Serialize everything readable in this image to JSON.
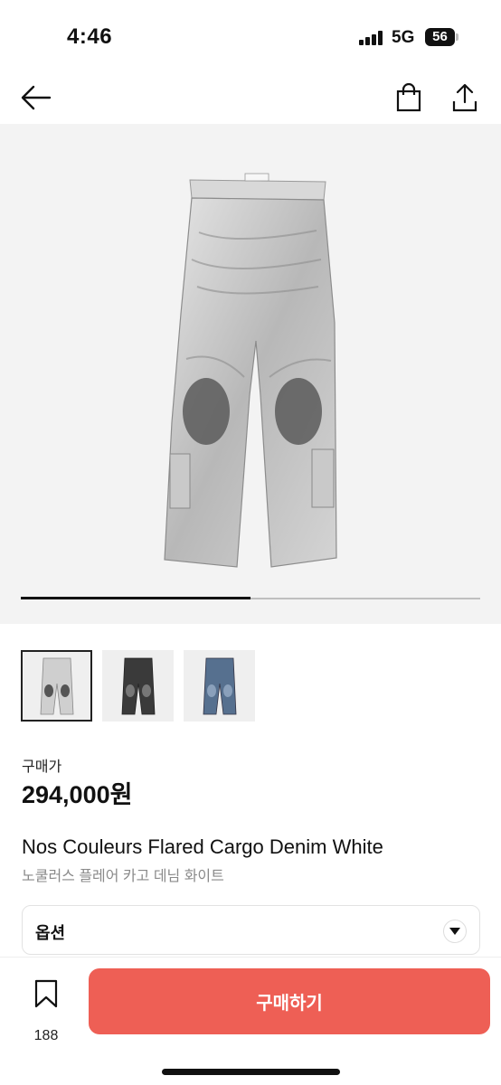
{
  "status_bar": {
    "time": "4:46",
    "network": "5G",
    "battery": "56"
  },
  "nav": {
    "back_icon": "arrow-left-icon",
    "bag_icon": "shopping-bag-icon",
    "share_icon": "share-icon"
  },
  "gallery": {
    "progress_fraction": 0.5,
    "thumbnails": [
      {
        "color": "white",
        "selected": true
      },
      {
        "color": "black",
        "selected": false
      },
      {
        "color": "blue",
        "selected": false
      }
    ]
  },
  "product": {
    "price_label": "구매가",
    "price": "294,000원",
    "name_en": "Nos Couleurs Flared Cargo Denim White",
    "name_ko": "노쿨러스 플레어 카고 데님 화이트"
  },
  "options": {
    "label": "옵션"
  },
  "bottom_bar": {
    "wishlist_count": "188",
    "buy_label": "구매하기"
  },
  "colors": {
    "accent": "#ee5f55"
  }
}
